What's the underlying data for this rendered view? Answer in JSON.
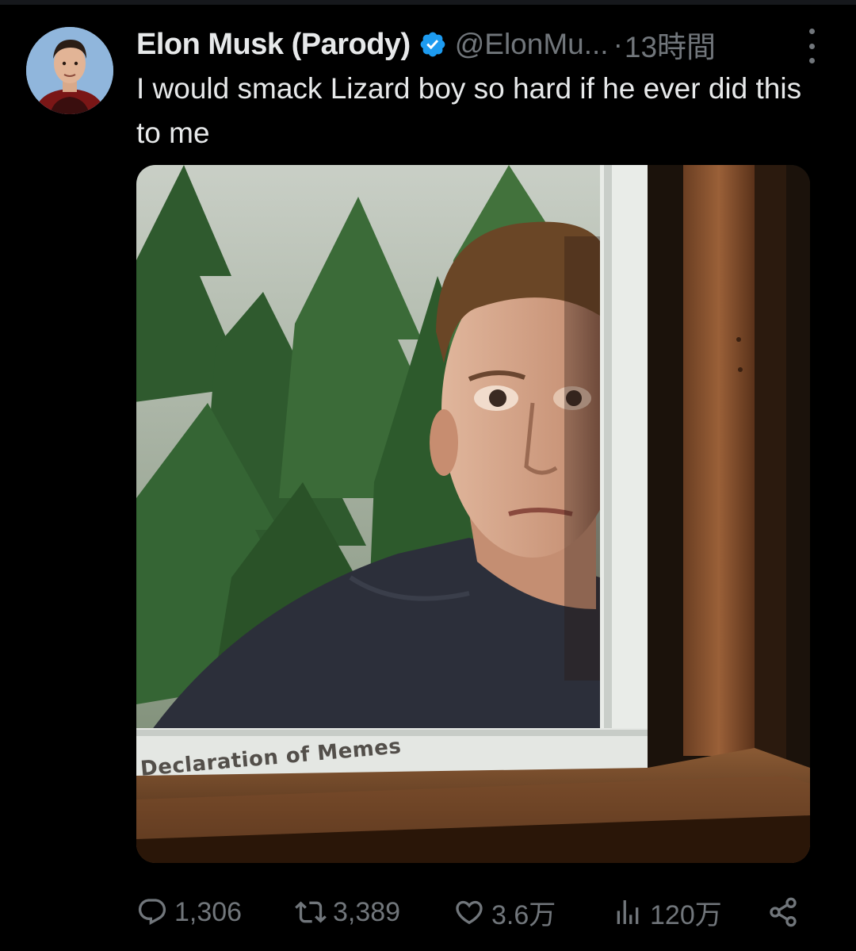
{
  "tweet": {
    "author_name": "Elon Musk (Parody)",
    "author_handle": "@ElonMu...",
    "separator": "·",
    "timestamp": "13時間",
    "text": "I would smack Lizard boy so hard if he ever did this to me"
  },
  "media": {
    "watermark": "Declaration of Memes"
  },
  "actions": {
    "replies": "1,306",
    "reposts": "3,389",
    "likes": "3.6万",
    "views": "120万"
  },
  "colors": {
    "background": "#000000",
    "text": "#e7e9ea",
    "muted": "#71767b",
    "verified": "#1d9bf0"
  }
}
